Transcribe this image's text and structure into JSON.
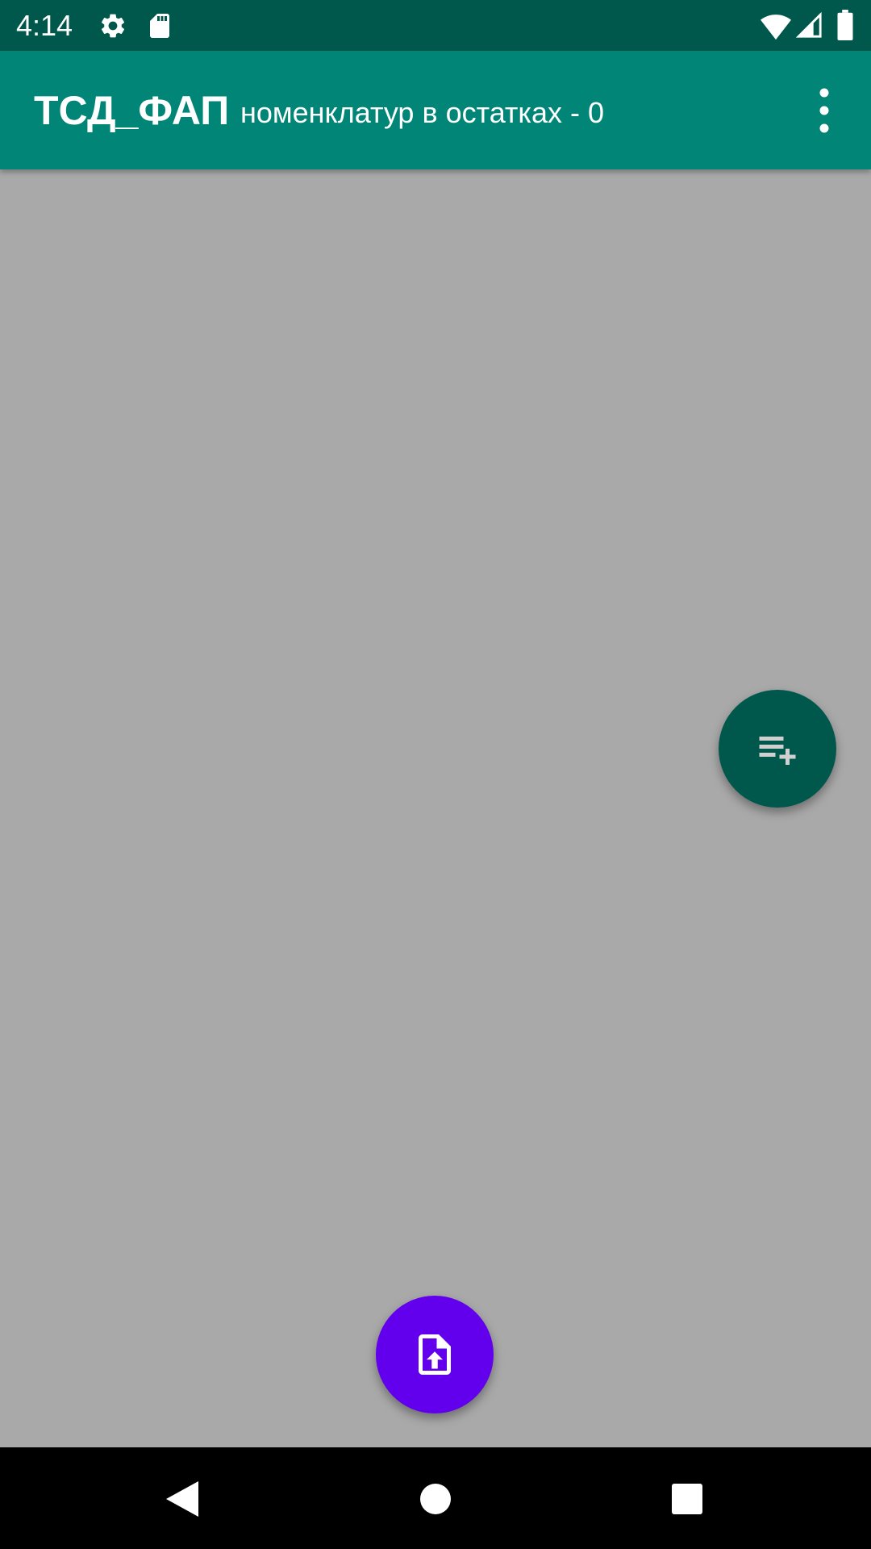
{
  "status_bar": {
    "time": "4:14",
    "icons": [
      "settings-icon",
      "sd-card-icon",
      "wifi-icon",
      "signal-icon",
      "battery-icon"
    ],
    "background_color": "#00574b"
  },
  "app_bar": {
    "title": "ТСД_ФАП",
    "subtitle": "номенклатур в остатках - 0",
    "menu_icon": "more-vert-icon",
    "background_color": "#008577"
  },
  "content": {
    "background_color": "#a9a9a9"
  },
  "fabs": {
    "add_list": {
      "icon": "playlist-add-icon",
      "color": "#00574b"
    },
    "upload_file": {
      "icon": "file-upload-icon",
      "color": "#6200ee"
    }
  },
  "nav_bar": {
    "buttons": [
      "back-icon",
      "home-icon",
      "recents-icon"
    ]
  }
}
